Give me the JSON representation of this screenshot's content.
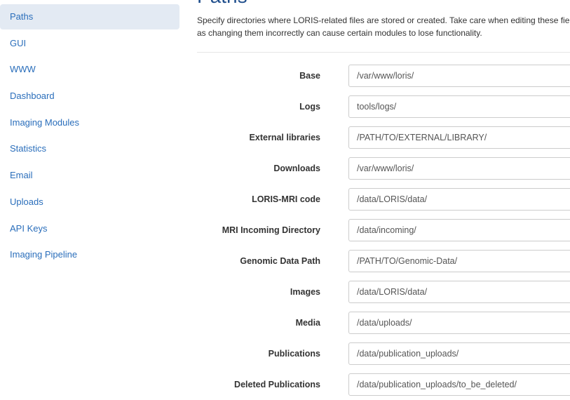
{
  "sidebar": {
    "items": [
      {
        "label": "Paths",
        "active": true
      },
      {
        "label": "GUI",
        "active": false
      },
      {
        "label": "WWW",
        "active": false
      },
      {
        "label": "Dashboard",
        "active": false
      },
      {
        "label": "Imaging Modules",
        "active": false
      },
      {
        "label": "Statistics",
        "active": false
      },
      {
        "label": "Email",
        "active": false
      },
      {
        "label": "Uploads",
        "active": false
      },
      {
        "label": "API Keys",
        "active": false
      },
      {
        "label": "Imaging Pipeline",
        "active": false
      }
    ]
  },
  "main": {
    "title": "Paths",
    "description": "Specify directories where LORIS-related files are stored or created. Take care when editing these fields as changing them incorrectly can cause certain modules to lose functionality.",
    "fields": [
      {
        "label": "Base",
        "value": "/var/www/loris/"
      },
      {
        "label": "Logs",
        "value": "tools/logs/"
      },
      {
        "label": "External libraries",
        "value": "/PATH/TO/EXTERNAL/LIBRARY/"
      },
      {
        "label": "Downloads",
        "value": "/var/www/loris/"
      },
      {
        "label": "LORIS-MRI code",
        "value": "/data/LORIS/data/"
      },
      {
        "label": "MRI Incoming Directory",
        "value": "/data/incoming/"
      },
      {
        "label": "Genomic Data Path",
        "value": "/PATH/TO/Genomic-Data/"
      },
      {
        "label": "Images",
        "value": "/data/LORIS/data/"
      },
      {
        "label": "Media",
        "value": "/data/uploads/"
      },
      {
        "label": "Publications",
        "value": "/data/publication_uploads/"
      },
      {
        "label": "Deleted Publications",
        "value": "/data/publication_uploads/to_be_deleted/"
      }
    ]
  },
  "colors": {
    "link": "#2a6ebb",
    "active_bg": "#e3eaf3",
    "title": "#1f4e8c",
    "input_border": "#cccccc"
  }
}
